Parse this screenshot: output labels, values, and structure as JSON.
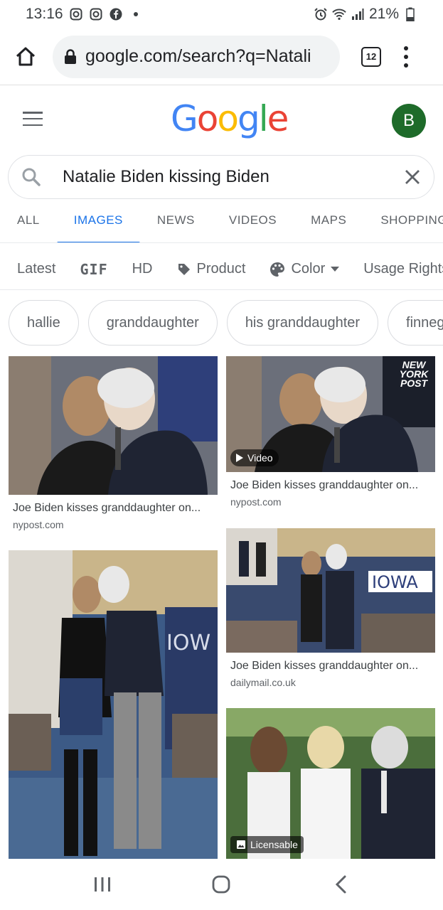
{
  "status": {
    "time": "13:16",
    "battery": "21%",
    "icons": [
      "instagram-icon",
      "instagram-icon",
      "facebook-icon",
      "dot-icon",
      "alarm-icon",
      "wifi-icon",
      "signal-icon",
      "battery-icon"
    ]
  },
  "browser": {
    "url": "google.com/search?q=Natali",
    "tab_count": "12"
  },
  "header": {
    "logo_letters": [
      {
        "ch": "G",
        "color": "#4285F4"
      },
      {
        "ch": "o",
        "color": "#EA4335"
      },
      {
        "ch": "o",
        "color": "#FBBC05"
      },
      {
        "ch": "g",
        "color": "#4285F4"
      },
      {
        "ch": "l",
        "color": "#34A853"
      },
      {
        "ch": "e",
        "color": "#EA4335"
      }
    ],
    "avatar_letter": "B"
  },
  "search": {
    "query": "Natalie Biden kissing Biden"
  },
  "tabs": [
    {
      "label": "ALL",
      "active": false
    },
    {
      "label": "IMAGES",
      "active": true
    },
    {
      "label": "NEWS",
      "active": false
    },
    {
      "label": "VIDEOS",
      "active": false
    },
    {
      "label": "MAPS",
      "active": false
    },
    {
      "label": "SHOPPING",
      "active": false
    }
  ],
  "filters": {
    "latest": "Latest",
    "gif": "GIF",
    "hd": "HD",
    "product": "Product",
    "color": "Color",
    "usage": "Usage Rights"
  },
  "chips": [
    "hallie",
    "granddaughter",
    "his granddaughter",
    "finnegan"
  ],
  "results": {
    "r1": {
      "title": "Joe Biden kisses granddaughter on...",
      "source": "nypost.com"
    },
    "r2": {
      "title": "Joe Biden kisses granddaughter on...",
      "source": "nypost.com",
      "badge": "Video",
      "watermark": "NEW YORK POST"
    },
    "r3": {
      "title": "Joe Biden kisses granddaughter on...",
      "source": "dailymail.co.uk"
    },
    "r4": {},
    "r5": {
      "badge": "Licensable"
    }
  },
  "colors": {
    "accent": "#1a73e8",
    "avatar_bg": "#1e6b2a"
  }
}
